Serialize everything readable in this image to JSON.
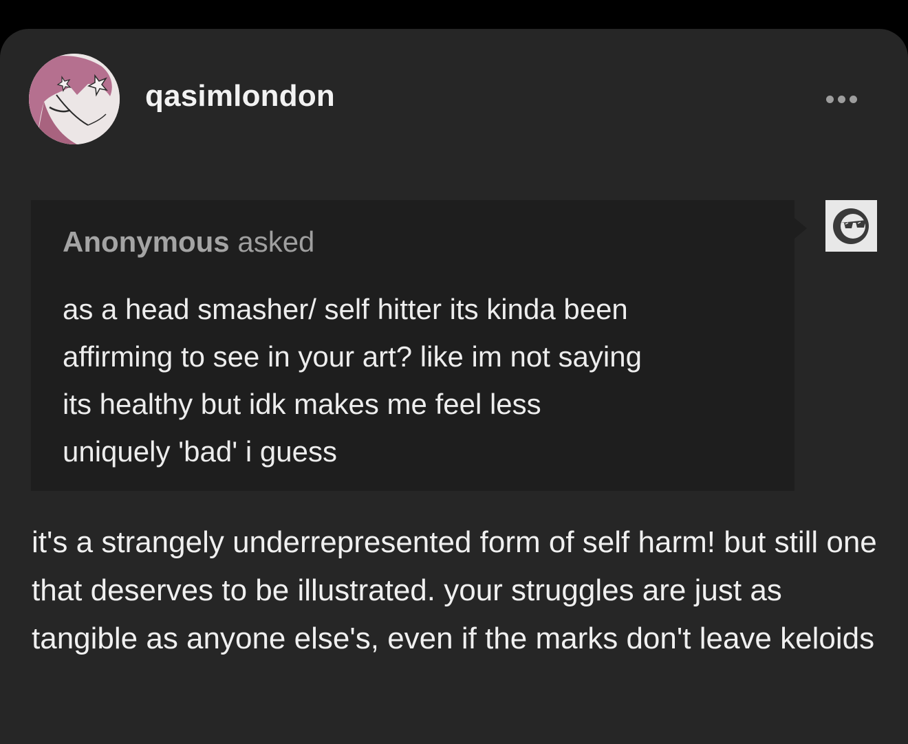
{
  "post": {
    "username": "qasimlondon",
    "avatar_icon": "anime-character-avatar",
    "more_icon": "ellipsis-icon"
  },
  "ask": {
    "asker_name": "Anonymous",
    "asker_verb": "asked",
    "question": "as a head smasher/ self hitter its kinda been\naffirming to see in your art? like im not saying\nits healthy but   idk  makes me feel less\nuniquely 'bad' i guess",
    "anon_avatar_icon": "sunglasses-face-icon"
  },
  "answer": {
    "text": "it's a strangely underrepresented form of self harm! but still one that deserves to be illustrated. your struggles are just as tangible as anyone else's, even if the marks don't leave keloids"
  },
  "colors": {
    "page_background": "#000000",
    "card_background": "#262626",
    "ask_background": "#1e1e1e",
    "avatar_hair": "#b5708f"
  }
}
